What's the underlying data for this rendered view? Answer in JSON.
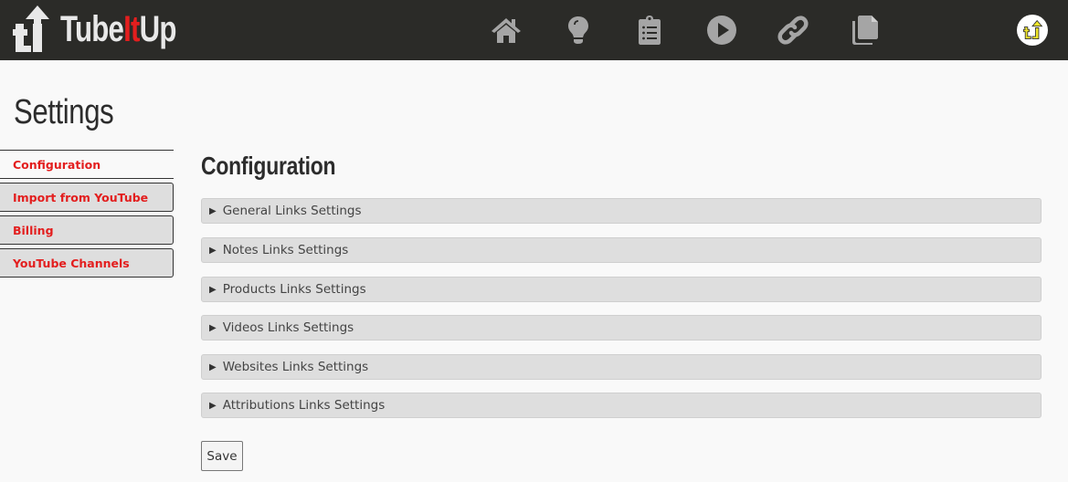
{
  "header": {
    "brand": {
      "prefix": "Tube",
      "highlight": "It",
      "suffix": "Up"
    },
    "brand_color": "#e31e1e",
    "nav_icons": [
      {
        "name": "home-icon"
      },
      {
        "name": "lightbulb-icon"
      },
      {
        "name": "clipboard-list-icon"
      },
      {
        "name": "play-circle-icon"
      },
      {
        "name": "link-icon"
      },
      {
        "name": "copy-icon"
      }
    ],
    "avatar_icon": "tubeitup-logo-avatar"
  },
  "page": {
    "title": "Settings"
  },
  "sidebar": {
    "items": [
      {
        "label": "Configuration",
        "active": true
      },
      {
        "label": "Import from YouTube",
        "active": false
      },
      {
        "label": "Billing",
        "active": false
      },
      {
        "label": "YouTube Channels",
        "active": false
      }
    ]
  },
  "main": {
    "title": "Configuration",
    "sections": [
      {
        "label": "General Links Settings",
        "expanded": false
      },
      {
        "label": "Notes Links Settings",
        "expanded": false
      },
      {
        "label": "Products Links Settings",
        "expanded": false
      },
      {
        "label": "Videos Links Settings",
        "expanded": false
      },
      {
        "label": "Websites Links Settings",
        "expanded": false
      },
      {
        "label": "Attributions Links Settings",
        "expanded": false
      }
    ],
    "expander_glyph": "▶",
    "save_label": "Save"
  }
}
